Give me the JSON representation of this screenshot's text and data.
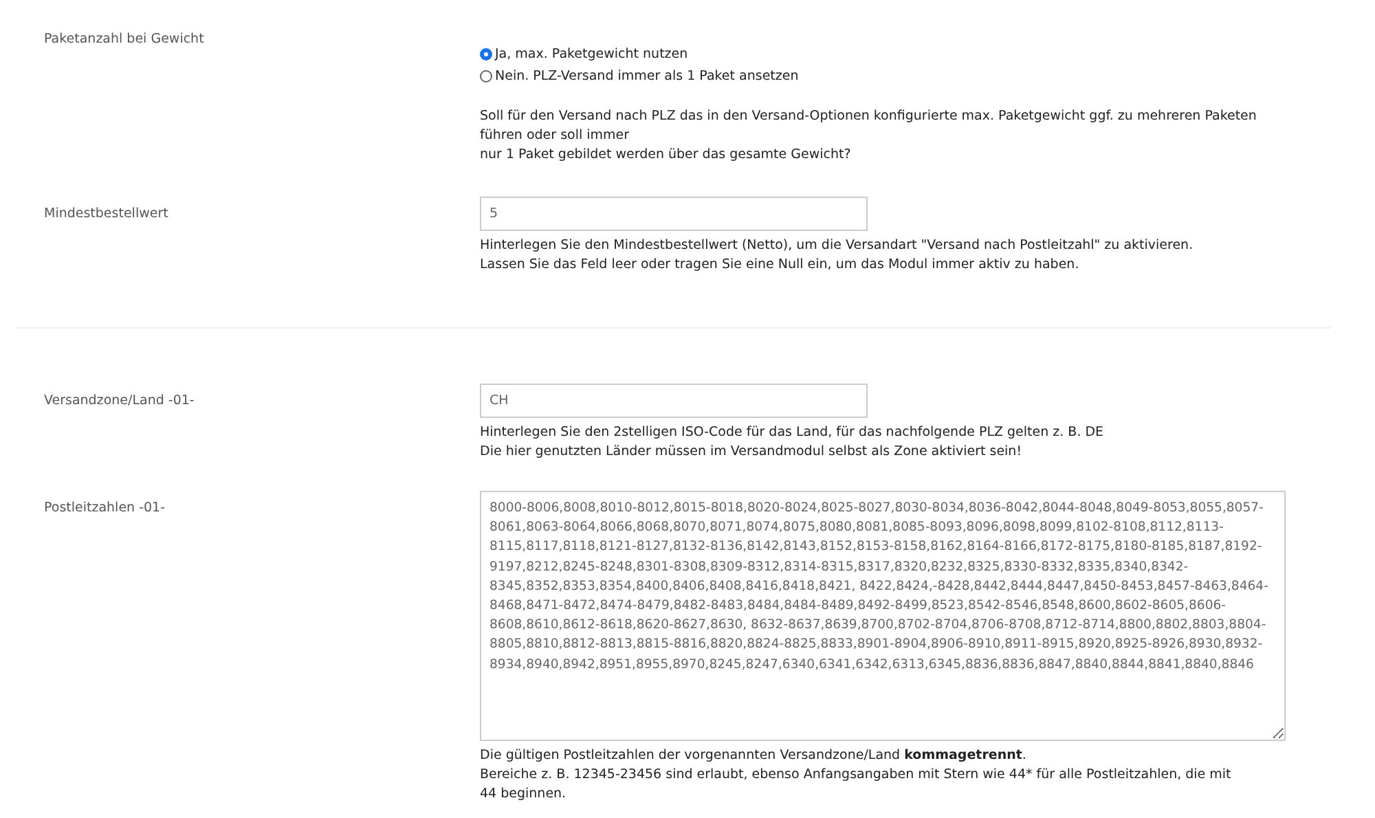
{
  "sections": [
    {
      "rows": [
        {
          "kind": "radio",
          "label": "Paketanzahl bei Gewicht",
          "options": [
            {
              "label": "Ja, max. Paketgewicht nutzen",
              "selected": true
            },
            {
              "label": "Nein. PLZ-Versand immer als 1 Paket ansetzen",
              "selected": false
            }
          ],
          "help": [
            "Soll für den Versand nach PLZ das in den Versand-Optionen konfigurierte max. Paketgewicht ggf. zu mehreren Paketen führen oder soll immer",
            "nur 1 Paket gebildet werden über das gesamte Gewicht?"
          ]
        },
        {
          "kind": "input",
          "label": "Mindestbestellwert",
          "value": "5",
          "help": [
            "Hinterlegen Sie den Mindestbestellwert (Netto), um die Versandart \"Versand nach Postleitzahl\" zu aktivieren.",
            "Lassen Sie das Feld leer oder tragen Sie eine Null ein, um das Modul immer aktiv zu haben."
          ]
        }
      ]
    },
    {
      "rows": [
        {
          "kind": "input",
          "label": "Versandzone/Land -01-",
          "value": "CH",
          "help": [
            "Hinterlegen Sie den 2stelligen ISO-Code für das Land, für das nachfolgende PLZ gelten z. B. DE",
            "Die hier genutzten Länder müssen im Versandmodul selbst als Zone aktiviert sein!"
          ]
        },
        {
          "kind": "textarea",
          "label": "Postleitzahlen -01-",
          "value": "8000-8006,8008,8010-8012,8015-8018,8020-8024,8025-8027,8030-8034,8036-8042,8044-8048,8049-8053,8055,8057-8061,8063-8064,8066,8068,8070,8071,8074,8075,8080,8081,8085-8093,8096,8098,8099,8102-8108,8112,8113-8115,8117,8118,8121-8127,8132-8136,8142,8143,8152,8153-8158,8162,8164-8166,8172-8175,8180-8185,8187,8192-9197,8212,8245-8248,8301-8308,8309-8312,8314-8315,8317,8320,8232,8325,8330-8332,8335,8340,8342-8345,8352,8353,8354,8400,8406,8408,8416,8418,8421, 8422,8424,-8428,8442,8444,8447,8450-8453,8457-8463,8464-8468,8471-8472,8474-8479,8482-8483,8484,8484-8489,8492-8499,8523,8542-8546,8548,8600,8602-8605,8606-8608,8610,8612-8618,8620-8627,8630, 8632-8637,8639,8700,8702-8704,8706-8708,8712-8714,8800,8802,8803,8804-8805,8810,8812-8813,8815-8816,8820,8824-8825,8833,8901-8904,8906-8910,8911-8915,8920,8925-8926,8930,8932-8934,8940,8942,8951,8955,8970,8245,8247,6340,6341,6342,6313,6345,8836,8836,8847,8840,8844,8841,8840,8846",
          "help": [
            "Die gültigen Postleitzahlen der vorgenannten Versandzone/Land **kommagetrennt**.",
            "Bereiche z. B. 12345-23456 sind erlaubt, ebenso Anfangsangaben mit Stern wie 44* für alle Postleitzahlen, die mit 44 beginnen."
          ]
        }
      ]
    }
  ]
}
